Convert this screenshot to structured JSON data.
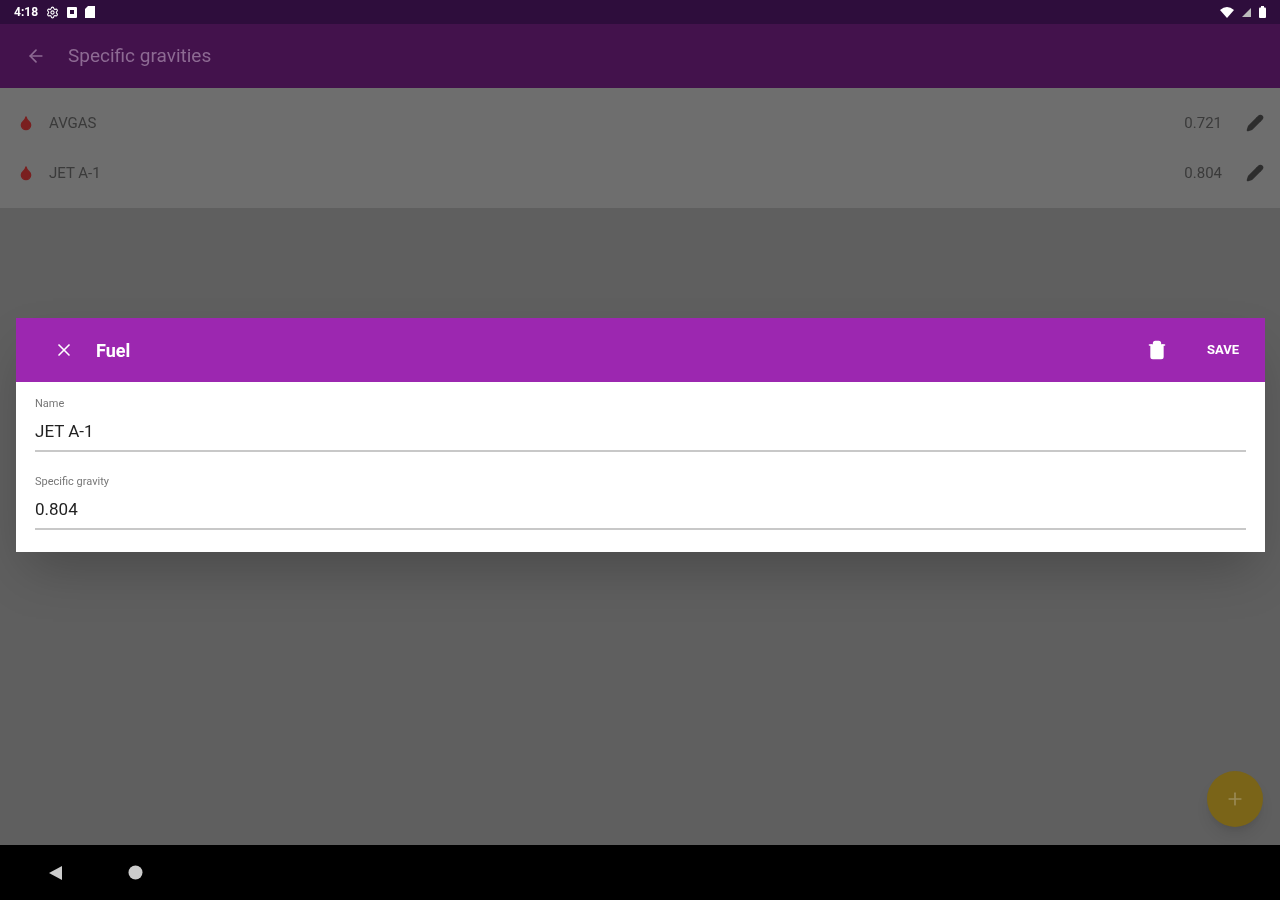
{
  "status_bar": {
    "time": "4:18"
  },
  "app_bar": {
    "title": "Specific gravities"
  },
  "fuels": [
    {
      "name": "AVGAS",
      "value": "0.721"
    },
    {
      "name": "JET A-1",
      "value": "0.804"
    }
  ],
  "dialog": {
    "title": "Fuel",
    "action": "SAVE",
    "fields": [
      {
        "label": "Name",
        "value": "JET A-1"
      },
      {
        "label": "Specific gravity",
        "value": "0.804"
      }
    ]
  }
}
